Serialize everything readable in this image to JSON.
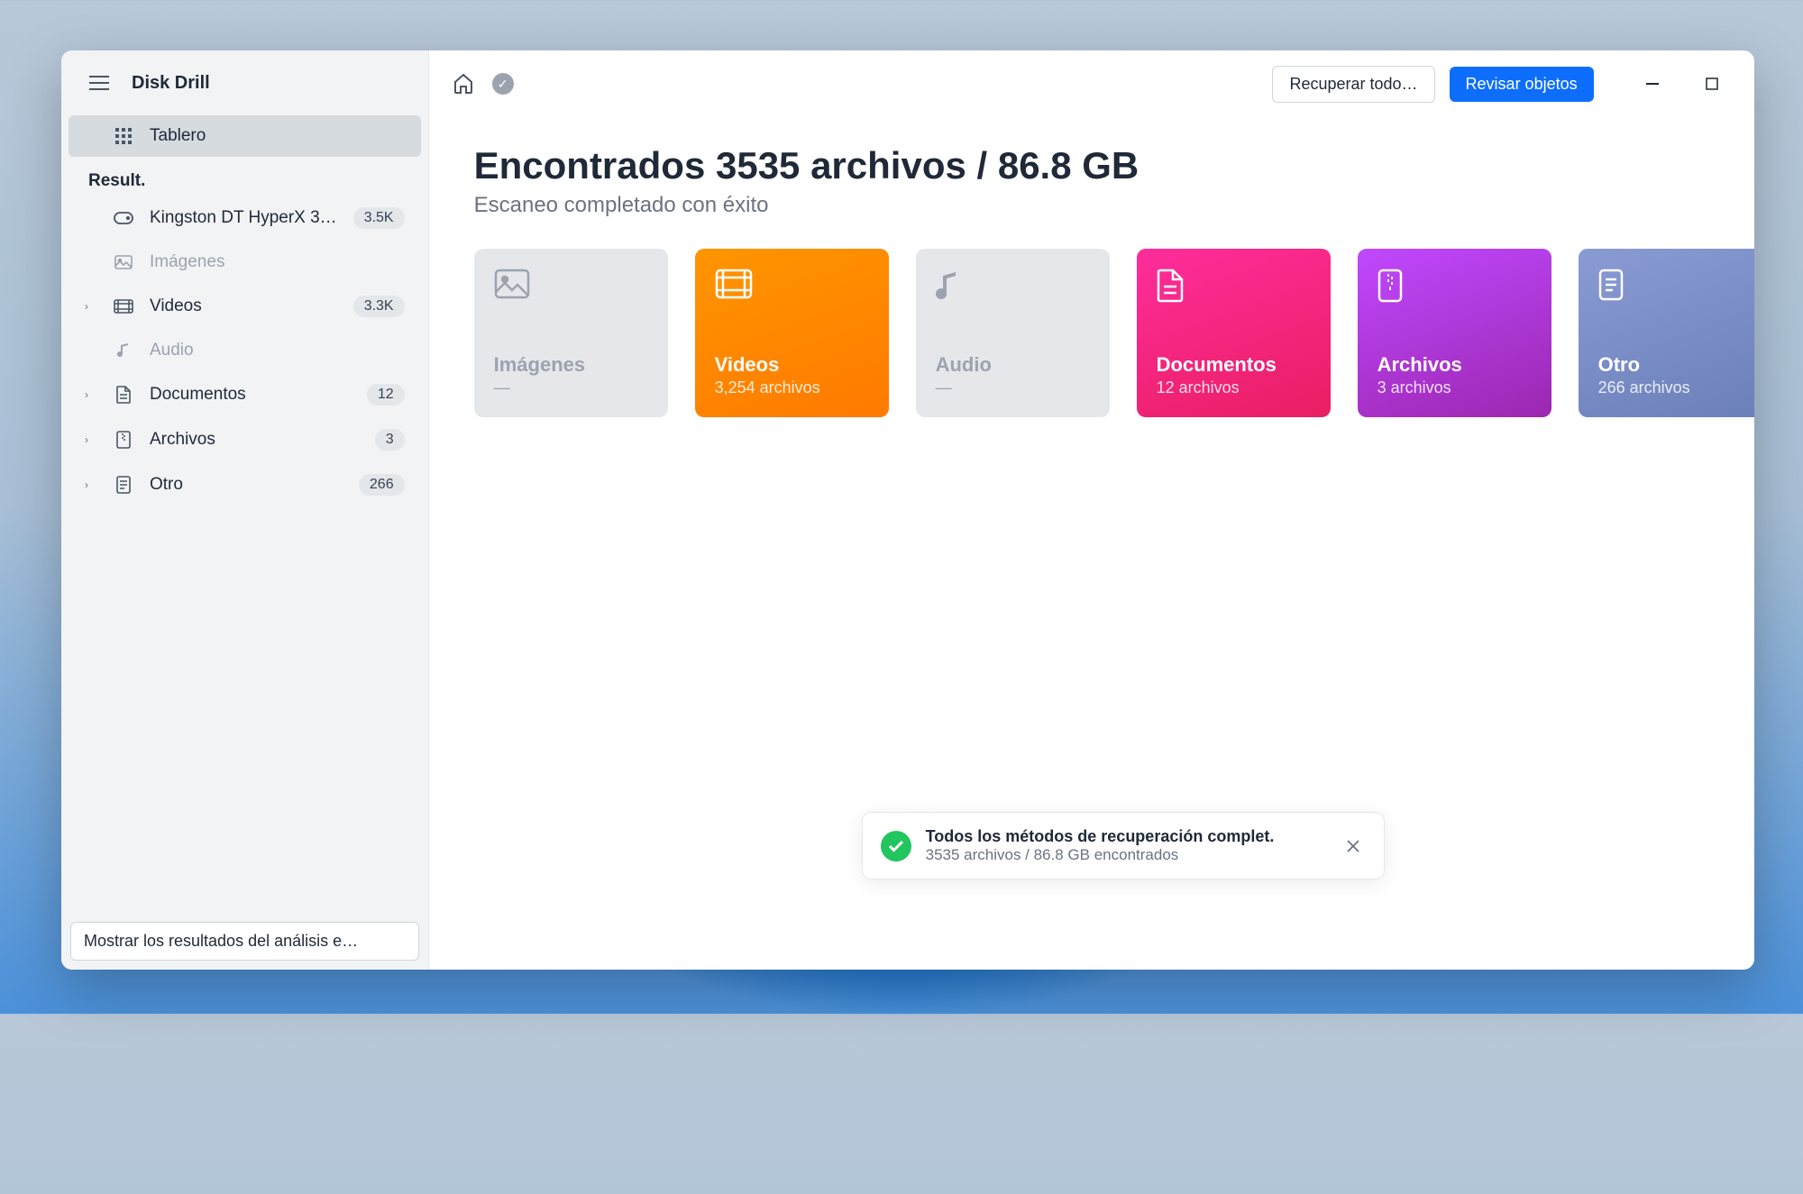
{
  "app": {
    "title": "Disk Drill"
  },
  "sidebar": {
    "board_label": "Tablero",
    "section_label": "Result.",
    "items": [
      {
        "label": "Kingston DT HyperX 3…",
        "count": "3.5K"
      },
      {
        "label": "Imágenes"
      },
      {
        "label": "Videos",
        "count": "3.3K"
      },
      {
        "label": "Audio"
      },
      {
        "label": "Documentos",
        "count": "12"
      },
      {
        "label": "Archivos",
        "count": "3"
      },
      {
        "label": "Otro",
        "count": "266"
      }
    ],
    "footer_button": "Mostrar los resultados del análisis e…"
  },
  "topbar": {
    "recover_all": "Recuperar todo…",
    "review": "Revisar objetos"
  },
  "main": {
    "heading": "Encontrados 3535 archivos / 86.8 GB",
    "subtitle": "Escaneo completado con éxito",
    "cards": {
      "imagenes": {
        "title": "Imágenes",
        "count": "—"
      },
      "videos": {
        "title": "Videos",
        "count": "3,254 archivos"
      },
      "audio": {
        "title": "Audio",
        "count": "—"
      },
      "documentos": {
        "title": "Documentos",
        "count": "12 archivos"
      },
      "archivos": {
        "title": "Archivos",
        "count": "3 archivos"
      },
      "otro": {
        "title": "Otro",
        "count": "266 archivos"
      }
    }
  },
  "toast": {
    "title": "Todos los métodos de recuperación complet.",
    "subtitle": "3535 archivos / 86.8 GB encontrados"
  }
}
